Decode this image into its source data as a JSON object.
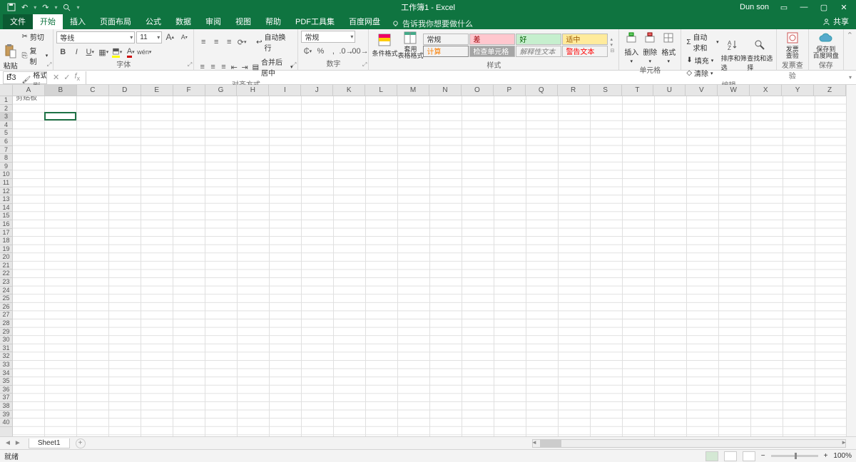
{
  "title": {
    "workbook": "工作簿1",
    "app": "Excel",
    "sep": "-"
  },
  "user": "Dun son",
  "qat": {
    "save": "💾",
    "undo": "↶",
    "redo": "↷",
    "search": "🔍"
  },
  "winctrl": {
    "min": "—",
    "max": "▢",
    "close": "✕",
    "ribmin": "▭"
  },
  "tabs": {
    "file": "文件",
    "home": "开始",
    "insert": "插入",
    "pagelayout": "页面布局",
    "formulas": "公式",
    "data": "数据",
    "review": "审阅",
    "view": "视图",
    "help": "帮助",
    "pdf": "PDF工具集",
    "baidu": "百度网盘",
    "tellme": "告诉我你想要做什么",
    "share": "共享"
  },
  "clipboard": {
    "paste": "粘贴",
    "cut": "剪切",
    "copy": "复制",
    "formatpainter": "格式刷",
    "label": "剪贴板"
  },
  "font": {
    "name": "等线",
    "size": "11",
    "label": "字体",
    "grow": "A",
    "shrink": "A"
  },
  "align": {
    "label": "对齐方式",
    "wrap": "自动换行",
    "merge": "合并后居中"
  },
  "number": {
    "format": "常规",
    "label": "数字"
  },
  "styles": {
    "condfmt": "条件格式",
    "tablefmt": "套用\n表格格式",
    "cellstyle": "单元格样式",
    "s1": "常规",
    "s2": "差",
    "s3": "好",
    "s4": "适中",
    "s5": "计算",
    "s6": "检查单元格",
    "s7": "解释性文本",
    "s8": "警告文本",
    "label": "样式"
  },
  "cells": {
    "insert": "插入",
    "delete": "删除",
    "format": "格式",
    "label": "单元格"
  },
  "editing": {
    "autosum": "自动求和",
    "fill": "填充",
    "clear": "清除",
    "sortfilter": "排序和筛选",
    "findselect": "查找和选择",
    "label": "编辑"
  },
  "invoice": {
    "check": "发票\n查验",
    "label": "发票查验"
  },
  "save": {
    "baidu": "保存到\n百度网盘",
    "label": "保存"
  },
  "namebox": "B3",
  "columns": [
    "A",
    "B",
    "C",
    "D",
    "E",
    "F",
    "G",
    "H",
    "I",
    "J",
    "K",
    "L",
    "M",
    "N",
    "O",
    "P",
    "Q",
    "R",
    "S",
    "T",
    "U",
    "V",
    "W",
    "X",
    "Y",
    "Z"
  ],
  "rows": 40,
  "selected": {
    "col": 1,
    "row": 2
  },
  "sheet": {
    "name": "Sheet1"
  },
  "status": {
    "ready": "就绪",
    "zoom": "100%"
  }
}
